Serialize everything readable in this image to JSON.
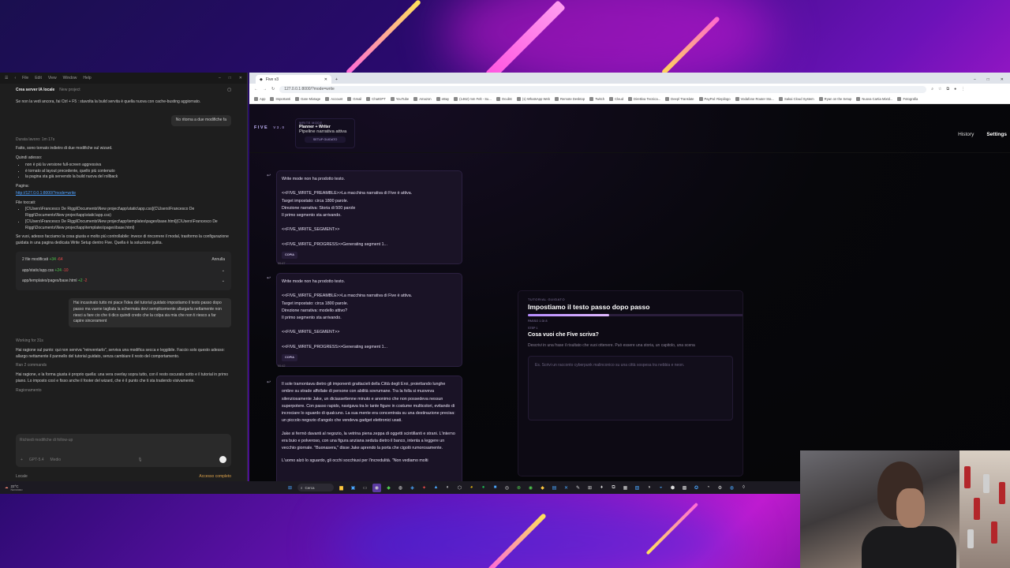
{
  "vscode": {
    "menu": [
      "File",
      "Edit",
      "View",
      "Window",
      "Help"
    ],
    "header_title": "Crea server IA locale",
    "header_sub": "New project",
    "intro": "Se non la vedi ancora, fai  Ctrl + F5  : stavolta la build servita è quella nuova con cache-busting aggiornato.",
    "user_msg_1": "No ritorna a due modifiche fa",
    "duration": "Durata lavoro: 1m 17s",
    "done_text": "Fatto, sono tornato indietro di due modifiche sul wizard.",
    "now_label": "Quindi adesso:",
    "now_items": [
      "non è più la versione full-screen aggressiva",
      "è tornato al layout precedente, quello più contenuto",
      "la pagina sta già servendo la build nuova del rollback"
    ],
    "page_label": "Pagina:",
    "page_link": "http://127.0.0.1:8000/?mode=write",
    "files_label": "File toccati:",
    "files_touched": [
      "[C\\Users\\Francesco De Riggi\\Documents\\New project\\app\\static\\app.css](C\\Users\\Francesco De Riggi\\Documents\\New project\\app\\static\\app.css)",
      "[C\\Users\\Francesco De Riggi\\Documents\\New project\\app\\templates\\pages\\base.html](C\\Users\\Francesco De Riggi\\Documents\\New project\\app\\templates\\pages\\base.html)"
    ],
    "suggestion": "Se vuoi, adesso facciamo la cosa giusta e molto più controllabile: invece di rincorrere il modal, trasformo la configurazione guidata in una pagina dedicata  Write Setup  dentro Five. Quella è la soluzione pulita.",
    "changes_title": "2 file modificati",
    "changes_add": "+34",
    "changes_del": "-64",
    "undo_label": "Annulla",
    "changed_files": [
      {
        "name": "app/static/app.css",
        "add": "+24",
        "del": "-10"
      },
      {
        "name": "app/templates/pages/base.html",
        "add": "+2",
        "del": "-2"
      }
    ],
    "user_msg_2": "Hai incasinato tutto mi piace l'idea del tutorial guidato impostiamo il testo passo dopo passo ma vuene tagliata la schermata devi semplicemente allargarla nettamente non riesci a fare cio che ti dico quindi credo che la colpa sia mia che non ti riesco a far capire sincerament",
    "working": "Working for 31s",
    "reply_1": "Hai ragione sul punto: qui non serviva \"reinventarlo\", serviva una modifica secca e leggibile. Faccio solo questo adesso: allargo nettamente il pannello del tutorial guidato, senza cambiare il resto del comportamento.",
    "ran_cmds": "Ran 2 commands",
    "reply_2": "Hai ragione, e la forma giusta è proprio quella: una vera overlay sopra tutto, con il resto oscurato sotto e il tutorial in primo piano. Lo imposto così e fisso anche il footer del wizard, che è il punto che ti sta tradendo visivamente.",
    "reasoning": "Ragionamento",
    "input_placeholder": "Richiedi modifiche di follow-up",
    "model": "GPT-5.4",
    "effort": "Medio",
    "footer_local": "Locale",
    "footer_access": "Accesso completo"
  },
  "browser": {
    "tab_title": "Five v3",
    "url": "127.0.0.1:8000/?mode=write",
    "bookmarks": [
      "App",
      "Importanti",
      "Gare Mixtage",
      "Account",
      "Gmail",
      "ChatGPT",
      "YouTube",
      "Amazon",
      "eBay",
      "(1462) mm Felt - Su...",
      "Oculist",
      "(1) WhatsApp Web",
      "Remote Desktop",
      "Twitch",
      "Cloud",
      "Direttiva Tecnica...",
      "Deepl Translate",
      "PayPal: Riepilogo",
      "Vodafone Router Sta...",
      "Sakai Cloud System",
      "Ryan on the Setup",
      "Nuova Cartia Mixtd...",
      "Fotografia"
    ]
  },
  "app": {
    "logo": "FIVE",
    "version": "V3.0",
    "mode_label": "WRITE MODE",
    "mode_title": "Planner + Writer",
    "mode_sub": "Pipeline narrativa attiva",
    "setup_button": "SETUP GUIDATO",
    "nav": [
      "History",
      "Settings"
    ],
    "messages": [
      {
        "lines": [
          "Write mode non ha prodotto testo.",
          "",
          "<<FIVE_WRITE_PREAMBLE>>La macchina narrativa di Five è attiva.",
          "Target impostato: circa 1800 parole.",
          "Direzione narrativa: Storia di 500 parole",
          "Il primo segmento sta arrivando.",
          "",
          "<<FIVE_WRITE_SEGMENT>>",
          "",
          "<<FIVE_WRITE_PROGRESS>>Generating segment 1..."
        ],
        "time": "00:47",
        "copy": "COPIA"
      },
      {
        "lines": [
          "Write mode non ha prodotto testo.",
          "",
          "<<FIVE_WRITE_PREAMBLE>>La macchina narrativa di Five è attiva.",
          "Target impostato: circa 1800 parole.",
          "Direzione narrativa: modello attivo?",
          "Il primo segmento sta arrivando.",
          "",
          "<<FIVE_WRITE_SEGMENT>>",
          "",
          "<<FIVE_WRITE_PROGRESS>>Generating segment 1..."
        ],
        "time": "00:42",
        "copy": "COPIA"
      }
    ],
    "story": [
      "Il sole tramontava dietro gli imponenti grattacieli della Città degli Eroi, proiettando lunghe ombre su strade affollate di persone con abilità sovrumane. Tra la folla si muoveva silenziosamente Jake, un diciassettenne minuto e anonimo che non possedeva nessun superpotere. Con passo rapido, navigava tra le tante figure in costume multicolori, evitando di incrociare lo sguardo di qualcuno. La sua mente era concentrata su una destinazione precisa: un piccolo negozio d'angolo che vendeva gadget elettronici usati.",
      "Jake si fermò davanti al negozio, la vetrina piena zeppa di oggetti scintillanti e strani. L'interno era buio e polveroso, con una figura anziana seduta dietro il banco, intenta a leggere un vecchio giornale. \"Buonasera,\" disse Jake aprendo la porta che cigolò rumorosamente.",
      "L'uomo alzò lo sguardo, gli occhi socchiusi per l'incredulità. \"Non vediamo molti"
    ],
    "wizard": {
      "eyebrow": "TUTORIAL GUIDATO",
      "title": "Impostiamo il testo passo dopo passo",
      "progress": 0.375,
      "step_counter": "PASSO 1 DI 8",
      "step_label": "STEP 1",
      "question": "Cosa vuoi che Five scriva?",
      "description": "Descrivi in una frase il risultato che vuoi ottenere. Può essere una storia, un capitolo, una scena",
      "placeholder": "Es. Scrivi un racconto cyberpunk malinconico su una città sospesa tra nebbia e neon."
    }
  },
  "taskbar": {
    "temperature": "22°C",
    "weather": "Nuvoloso",
    "search_label": "Cerca"
  },
  "colors": {
    "accent": "#b68cff",
    "bg_dark": "#07070b",
    "panel": "#1a1326"
  }
}
